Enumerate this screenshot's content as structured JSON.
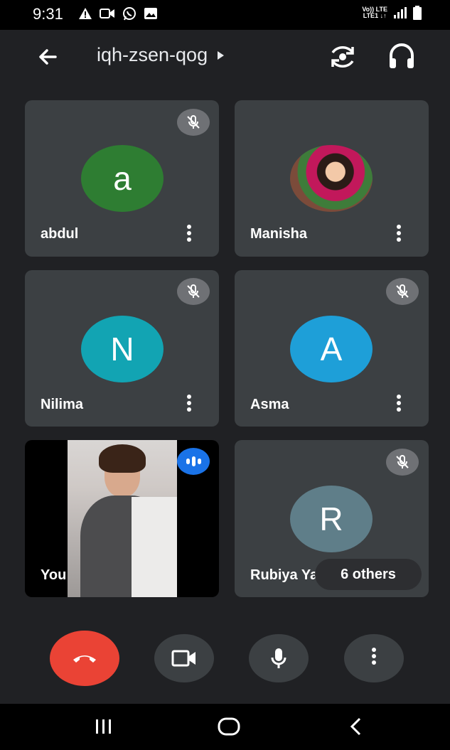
{
  "status_bar": {
    "time": "9:31",
    "network_top": "Vo)) LTE",
    "network_bottom": "LTE1 ↓↑"
  },
  "meeting": {
    "code": "iqh-zsen-qog"
  },
  "participants": [
    {
      "name": "abdul",
      "initial": "a",
      "avatar_color": "#2e7d32",
      "muted": true
    },
    {
      "name": "Manisha",
      "initial": "",
      "avatar_color": "#8d6e63",
      "muted": false,
      "photo": true
    },
    {
      "name": "Nilima",
      "initial": "N",
      "avatar_color": "#12a4b3",
      "muted": true
    },
    {
      "name": "Asma",
      "initial": "A",
      "avatar_color": "#1e9fd8",
      "muted": true
    },
    {
      "name": "You",
      "initial": "",
      "speaking": true,
      "video": true
    },
    {
      "name": "Rubiya Yas",
      "initial": "R",
      "avatar_color": "#5f7e89",
      "muted": true
    }
  ],
  "others_label": "6 others",
  "controls": {
    "end_call": "end-call",
    "camera": "camera",
    "microphone": "microphone",
    "more": "more"
  },
  "colors": {
    "background": "#202124",
    "tile": "#3c4043",
    "end_call": "#ea4335",
    "speaking": "#1a73e8"
  }
}
